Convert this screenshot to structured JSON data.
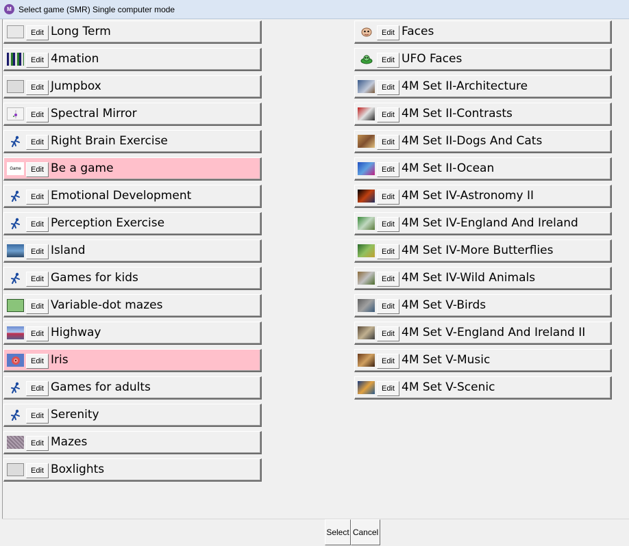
{
  "window": {
    "title": "Select game (SMR) Single computer mode",
    "icon_text": "M"
  },
  "edit_label": "Edit",
  "left_games": [
    {
      "label": "Long Term",
      "thumb": "t-blank",
      "selected": false
    },
    {
      "label": "4mation",
      "thumb": "t-pixel",
      "selected": false
    },
    {
      "label": "Jumpbox",
      "thumb": "t-gray",
      "selected": false
    },
    {
      "label": "Spectral Mirror",
      "thumb": "t-spectral",
      "selected": false
    },
    {
      "label": "Right Brain Exercise",
      "thumb": "t-runner",
      "selected": false
    },
    {
      "label": "Be a game",
      "thumb": "t-text",
      "thumb_text": "Game",
      "selected": true
    },
    {
      "label": "Emotional Development",
      "thumb": "t-runner",
      "selected": false
    },
    {
      "label": "Perception Exercise",
      "thumb": "t-runner",
      "selected": false
    },
    {
      "label": "Island",
      "thumb": "t-photo-blue",
      "selected": false
    },
    {
      "label": "Games for kids",
      "thumb": "t-runner",
      "selected": false
    },
    {
      "label": "Variable-dot mazes",
      "thumb": "t-green",
      "selected": false
    },
    {
      "label": "Highway",
      "thumb": "t-highway",
      "selected": false
    },
    {
      "label": "Iris",
      "thumb": "t-iris",
      "selected": true
    },
    {
      "label": "Games for adults",
      "thumb": "t-runner",
      "selected": false
    },
    {
      "label": "Serenity",
      "thumb": "t-runner",
      "selected": false
    },
    {
      "label": "Mazes",
      "thumb": "t-maze",
      "selected": false
    },
    {
      "label": "Boxlights",
      "thumb": "t-gray",
      "selected": false
    }
  ],
  "right_games": [
    {
      "label": "Faces",
      "thumb": "t-face",
      "selected": false
    },
    {
      "label": "UFO Faces",
      "thumb": "t-ufo",
      "selected": false
    },
    {
      "label": "4M Set II-Architecture",
      "thumb": "t-arch",
      "selected": false
    },
    {
      "label": "4M Set II-Contrasts",
      "thumb": "t-contr",
      "selected": false
    },
    {
      "label": "4M Set II-Dogs And Cats",
      "thumb": "t-dogs",
      "selected": false
    },
    {
      "label": "4M Set II-Ocean",
      "thumb": "t-ocean",
      "selected": false
    },
    {
      "label": "4M Set IV-Astronomy II",
      "thumb": "t-astro",
      "selected": false
    },
    {
      "label": "4M Set IV-England And Ireland",
      "thumb": "t-eng",
      "selected": false
    },
    {
      "label": "4M Set IV-More Butterflies",
      "thumb": "t-butter",
      "selected": false
    },
    {
      "label": "4M Set IV-Wild Animals",
      "thumb": "t-wild",
      "selected": false
    },
    {
      "label": "4M Set V-Birds",
      "thumb": "t-birds",
      "selected": false
    },
    {
      "label": "4M Set V-England And Ireland II",
      "thumb": "t-eng2",
      "selected": false
    },
    {
      "label": "4M Set V-Music",
      "thumb": "t-music",
      "selected": false
    },
    {
      "label": "4M Set V-Scenic",
      "thumb": "t-scenic",
      "selected": false
    }
  ],
  "buttons": {
    "select": "Select",
    "cancel": "Cancel"
  },
  "colors": {
    "selected_row": "#ffc0cb",
    "titlebar": "#dbe6f4"
  }
}
